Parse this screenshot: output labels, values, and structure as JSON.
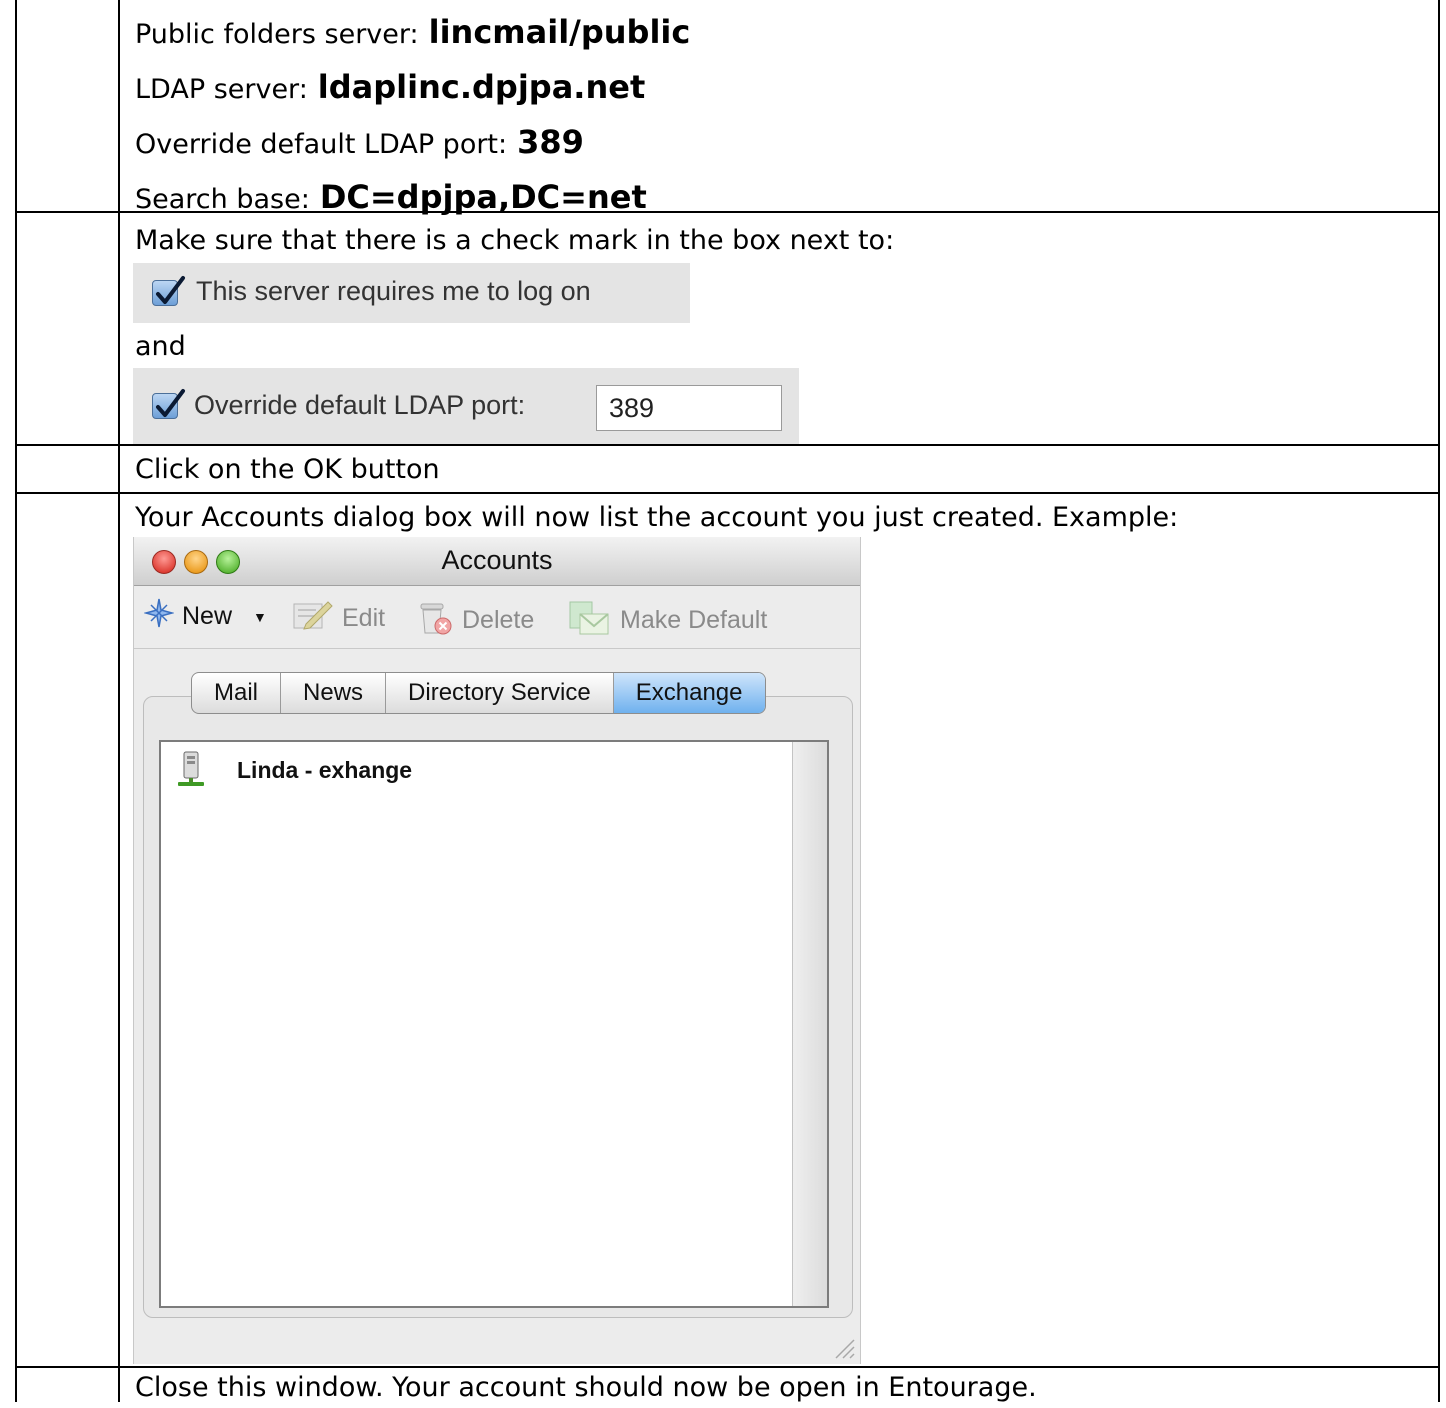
{
  "settings": {
    "public_folders_label": "Public folders server:",
    "public_folders_value": "lincmail/public",
    "ldap_server_label": "LDAP server:",
    "ldap_server_value": "ldaplinc.dpjpa.net",
    "ldap_port_label": "Override default LDAP port:",
    "ldap_port_value": "389",
    "search_base_label": "Search base:",
    "search_base_value": "DC=dpjpa,DC=net"
  },
  "checkmark_step": {
    "instruction": "Make sure that there is a check mark in the box next to:",
    "checkbox1_label": "This server requires me to log on",
    "and_text": "and",
    "checkbox2_label": "Override default LDAP port:",
    "checkbox2_port": "389"
  },
  "ok_step": {
    "instruction": "Click on the OK button"
  },
  "accounts_step": {
    "instruction": "Your Accounts dialog box will now list the account you just created. Example:"
  },
  "accounts_window": {
    "title": "Accounts",
    "toolbar": {
      "new_label": "New",
      "edit_label": "Edit",
      "delete_label": "Delete",
      "make_default_label": "Make Default"
    },
    "tabs": [
      "Mail",
      "News",
      "Directory Service",
      "Exchange"
    ],
    "active_tab": "Exchange",
    "accounts": [
      {
        "name": "Linda - exhange"
      }
    ]
  },
  "close_step": {
    "instruction": "Close this window.  Your account should now be open in Entourage."
  }
}
